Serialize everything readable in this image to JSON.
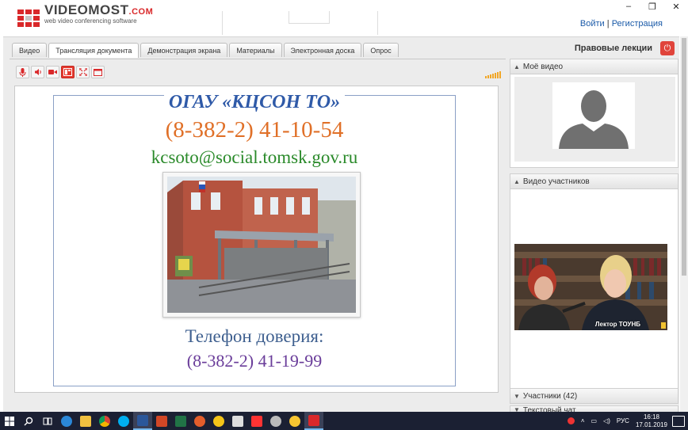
{
  "window": {
    "minimize": "–",
    "restore": "❐",
    "close": "✕"
  },
  "header": {
    "logo_brand": "VIDEOMOST",
    "logo_suffix": ".COM",
    "logo_tagline": "web video conferencing software",
    "login": "Войти",
    "separator": " | ",
    "register": "Регистрация"
  },
  "tabs": [
    {
      "label": "Видео",
      "active": false
    },
    {
      "label": "Трансляция документа",
      "active": true
    },
    {
      "label": "Демонстрация экрана",
      "active": false
    },
    {
      "label": "Материалы",
      "active": false
    },
    {
      "label": "Электронная доска",
      "active": false
    },
    {
      "label": "Опрос",
      "active": false
    }
  ],
  "topic": "Правовые лекции",
  "toolbar": {
    "items": [
      {
        "icon": "microphone-icon"
      },
      {
        "icon": "speaker-icon"
      },
      {
        "icon": "camera-icon"
      },
      {
        "icon": "document-view-icon",
        "active": true
      },
      {
        "icon": "fullscreen-icon"
      },
      {
        "icon": "window-icon"
      }
    ]
  },
  "slide": {
    "title": "ОГАУ «КЦСОН ТО»",
    "phone": "(8-382-2) 41-10-54",
    "email": "kcsoto@social.tomsk.gov.ru",
    "trust_label": "Телефон доверия:",
    "trust_phone": "(8-382-2) 41-19-99"
  },
  "right_panel": {
    "my_video": "Моё видео",
    "participants_video": "Видео участников",
    "camera_label": "Лектор ТОУНБ",
    "participants": "Участники (42)",
    "chat": "Текстовый чат"
  },
  "taskbar": {
    "language": "РУС",
    "time": "16:18",
    "date": "17.01.2019"
  },
  "colors": {
    "accent": "#d9282a",
    "slide_title": "#2f5aa8",
    "slide_phone": "#e07028",
    "slide_email": "#2a8a2a",
    "trust_label": "#3e5f8f",
    "trust_phone": "#6a3d9a",
    "taskbar": "#1b2033"
  }
}
